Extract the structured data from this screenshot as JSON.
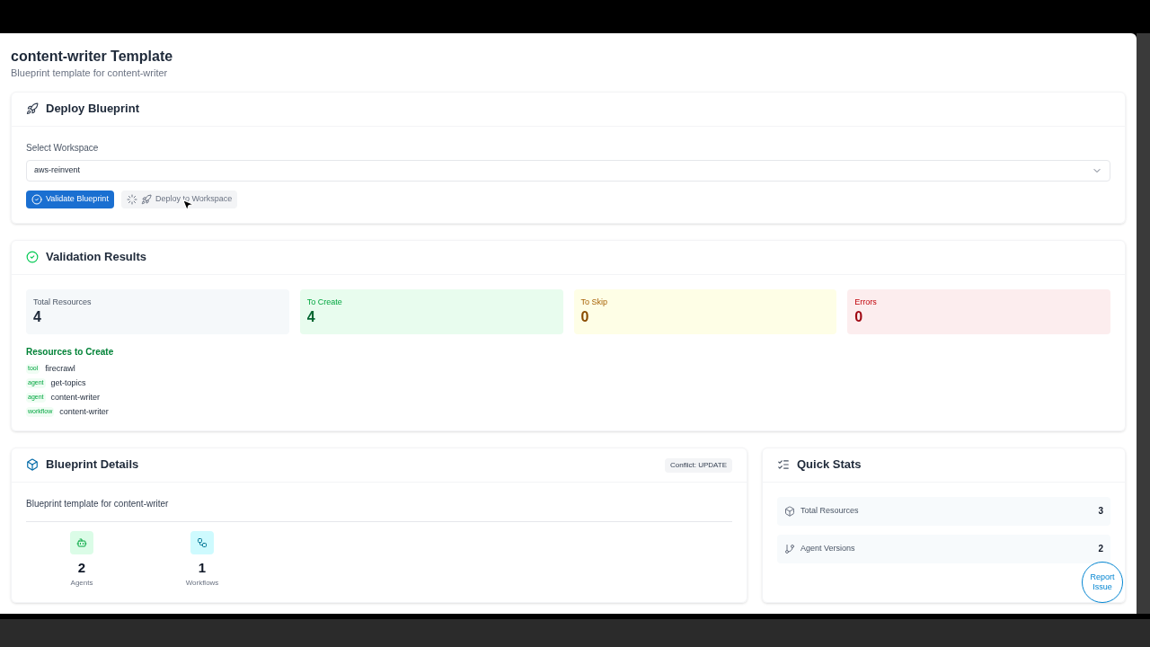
{
  "page": {
    "title": "content-writer Template",
    "subtitle": "Blueprint template for content-writer"
  },
  "deploy": {
    "title": "Deploy Blueprint",
    "field_label": "Select Workspace",
    "workspace": "aws-reinvent",
    "validate_button": "Validate Blueprint",
    "deploy_button": {
      "label": "Deploy to Workspace",
      "disabled": true,
      "loading": true
    }
  },
  "validation": {
    "title": "Validation Results",
    "stats": [
      {
        "label": "Total Resources",
        "value": "4",
        "kind": "neutral"
      },
      {
        "label": "To Create",
        "value": "4",
        "kind": "success"
      },
      {
        "label": "To Skip",
        "value": "0",
        "kind": "warning"
      },
      {
        "label": "Errors",
        "value": "0",
        "kind": "error"
      }
    ],
    "resources_heading": "Resources to Create",
    "resources": [
      {
        "tag": "tool",
        "name": "firecrawl"
      },
      {
        "tag": "agent",
        "name": "get-topics"
      },
      {
        "tag": "agent",
        "name": "content-writer"
      },
      {
        "tag": "workflow",
        "name": "content-writer"
      }
    ]
  },
  "details": {
    "title": "Blueprint Details",
    "badge": "Conflict: UPDATE",
    "description": "Blueprint template for content-writer",
    "counts": [
      {
        "kind": "agents",
        "value": "2",
        "label": "Agents"
      },
      {
        "kind": "workflows",
        "value": "1",
        "label": "Workflows"
      }
    ]
  },
  "quick_stats": {
    "title": "Quick Stats",
    "rows": [
      {
        "kind": "resources",
        "label": "Total Resources",
        "value": "3"
      },
      {
        "kind": "versions",
        "label": "Agent Versions",
        "value": "2"
      }
    ]
  },
  "report_button": "Report Issue"
}
